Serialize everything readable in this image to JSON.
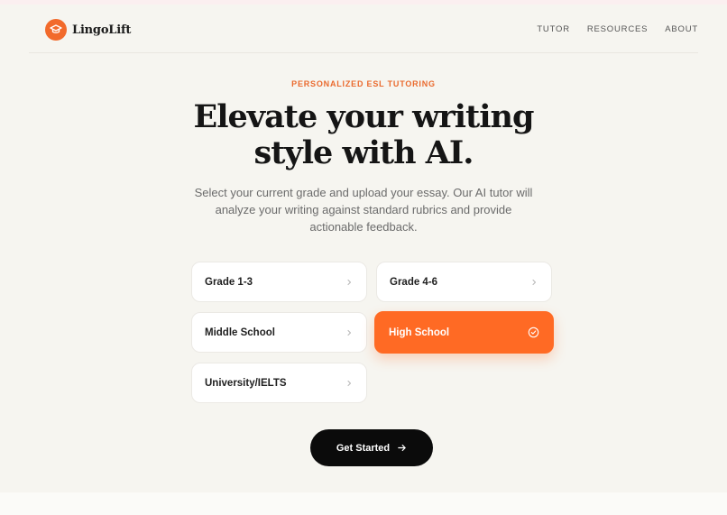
{
  "brand": {
    "name": "LingoLift",
    "accent": "#f26a2b"
  },
  "nav": {
    "items": [
      "TUTOR",
      "RESOURCES",
      "ABOUT"
    ]
  },
  "hero": {
    "eyebrow": "PERSONALIZED ESL TUTORING",
    "title_line1": "Elevate your writing",
    "title_line2": "style with AI.",
    "subtitle": "Select your current grade and upload your essay. Our AI tutor will analyze your writing against standard rubrics and provide actionable feedback."
  },
  "grades": {
    "selected": "High School",
    "options": [
      "Grade 1-3",
      "Grade 4-6",
      "Middle School",
      "High School",
      "University/IELTS"
    ]
  },
  "cta": {
    "label": "Get Started",
    "icon": "arrow-right-icon"
  },
  "colors": {
    "accent": "#ff6a24",
    "background": "#f6f5f0",
    "cta": "#0b0b0b"
  }
}
